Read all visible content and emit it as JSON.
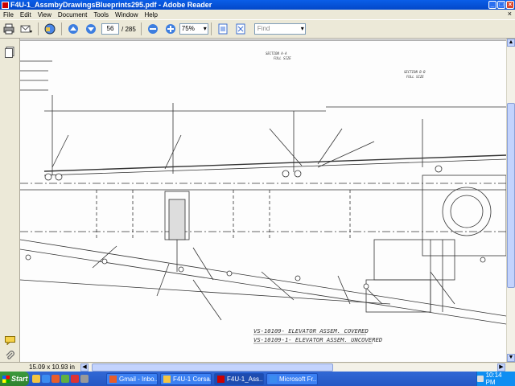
{
  "window": {
    "title": "F4U-1_AssmbyDrawingsBlueprints295.pdf - Adobe Reader"
  },
  "menu": [
    "File",
    "Edit",
    "View",
    "Document",
    "Tools",
    "Window",
    "Help"
  ],
  "toolbar": {
    "current_page": "56",
    "total_pages": "/ 285",
    "zoom": "75%",
    "find_placeholder": "Find"
  },
  "status": {
    "page_size": "15.09 x 10.93 in"
  },
  "drawing": {
    "section_a": "SECTION A-A",
    "full_size_a": "FULL SIZE",
    "section_b": "SECTION B-B",
    "full_size_b": "FULL SIZE",
    "title_covered": "VS-10109- ELEVATOR ASSEM. COVERED",
    "title_uncovered": "VS-10109-1- ELEVATOR ASSEM. UNCOVERED"
  },
  "taskbar": {
    "start": "Start",
    "tasks": [
      "Gmail - Inbo...",
      "F4U-1 Corsa...",
      "F4U-1_Ass...",
      "Microsoft Fr..."
    ],
    "active_task_index": 2,
    "clock": "10:14 PM"
  },
  "colors": {
    "titlebar": "#0a5ee8",
    "chrome": "#ece9d8",
    "taskbar": "#2457c4",
    "start": "#3c9a3c"
  }
}
